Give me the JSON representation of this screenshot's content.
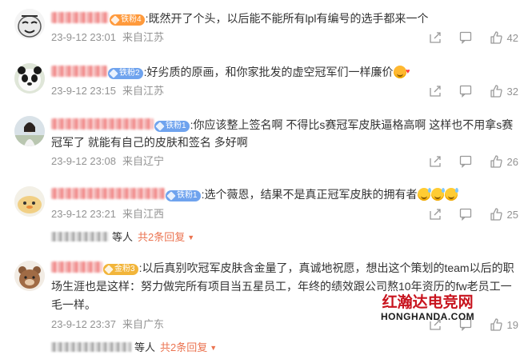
{
  "comments": [
    {
      "text": ":既然开了个头，以后能不能所有lpl有编号的选手都来一个",
      "badge": "铁粉4",
      "time": "23-9-12 23:01",
      "location": "来自江苏",
      "likes": "42",
      "avatar": "meme-face"
    },
    {
      "text": ":好劣质的原画，和你家批发的虚空冠军们一样廉价",
      "badge": "铁粉2",
      "time": "23-9-12 23:15",
      "location": "来自江苏",
      "likes": "32",
      "avatar": "panda"
    },
    {
      "text": ":你应该整上签名啊 不得比s赛冠军皮肤逼格高啊  这样也不用拿s赛冠军了 就能有自己的皮肤和签名 多好啊",
      "badge": "铁粉1",
      "time": "23-9-12 23:08",
      "location": "来自辽宁",
      "likes": "26",
      "avatar": "girl-photo"
    },
    {
      "text": ":选个薇恩，结果不是真正冠军皮肤的拥有者",
      "badge": "铁粉1",
      "time": "23-9-12 23:21",
      "location": "来自江西",
      "likes": "25",
      "avatar": "duck-cartoon",
      "reply_label": "等人",
      "reply_link": "共2条回复"
    },
    {
      "text": ":以后真别吹冠军皮肤含金量了，真诚地祝愿，想出这个策划的team以后的职场生涯也是这样：努力做完所有项目当五星员工，年终的绩效跟公司熬10年资历的fw老员工一毛一样。",
      "badge": "金粉3",
      "time": "23-9-12 23:37",
      "location": "来自广东",
      "likes": "19",
      "avatar": "bear-cartoon",
      "reply_label": "等人",
      "reply_link": "共2条回复"
    }
  ],
  "watermark": {
    "cn": "红瀚达电竞网",
    "en": "HONGHANDA.COM"
  },
  "colors": {
    "meta": "#939393",
    "link": "#eb7350",
    "watermark_red": "#c8141e"
  },
  "icons": [
    "share-icon",
    "comment-icon",
    "like-icon",
    "caret-down-icon"
  ]
}
